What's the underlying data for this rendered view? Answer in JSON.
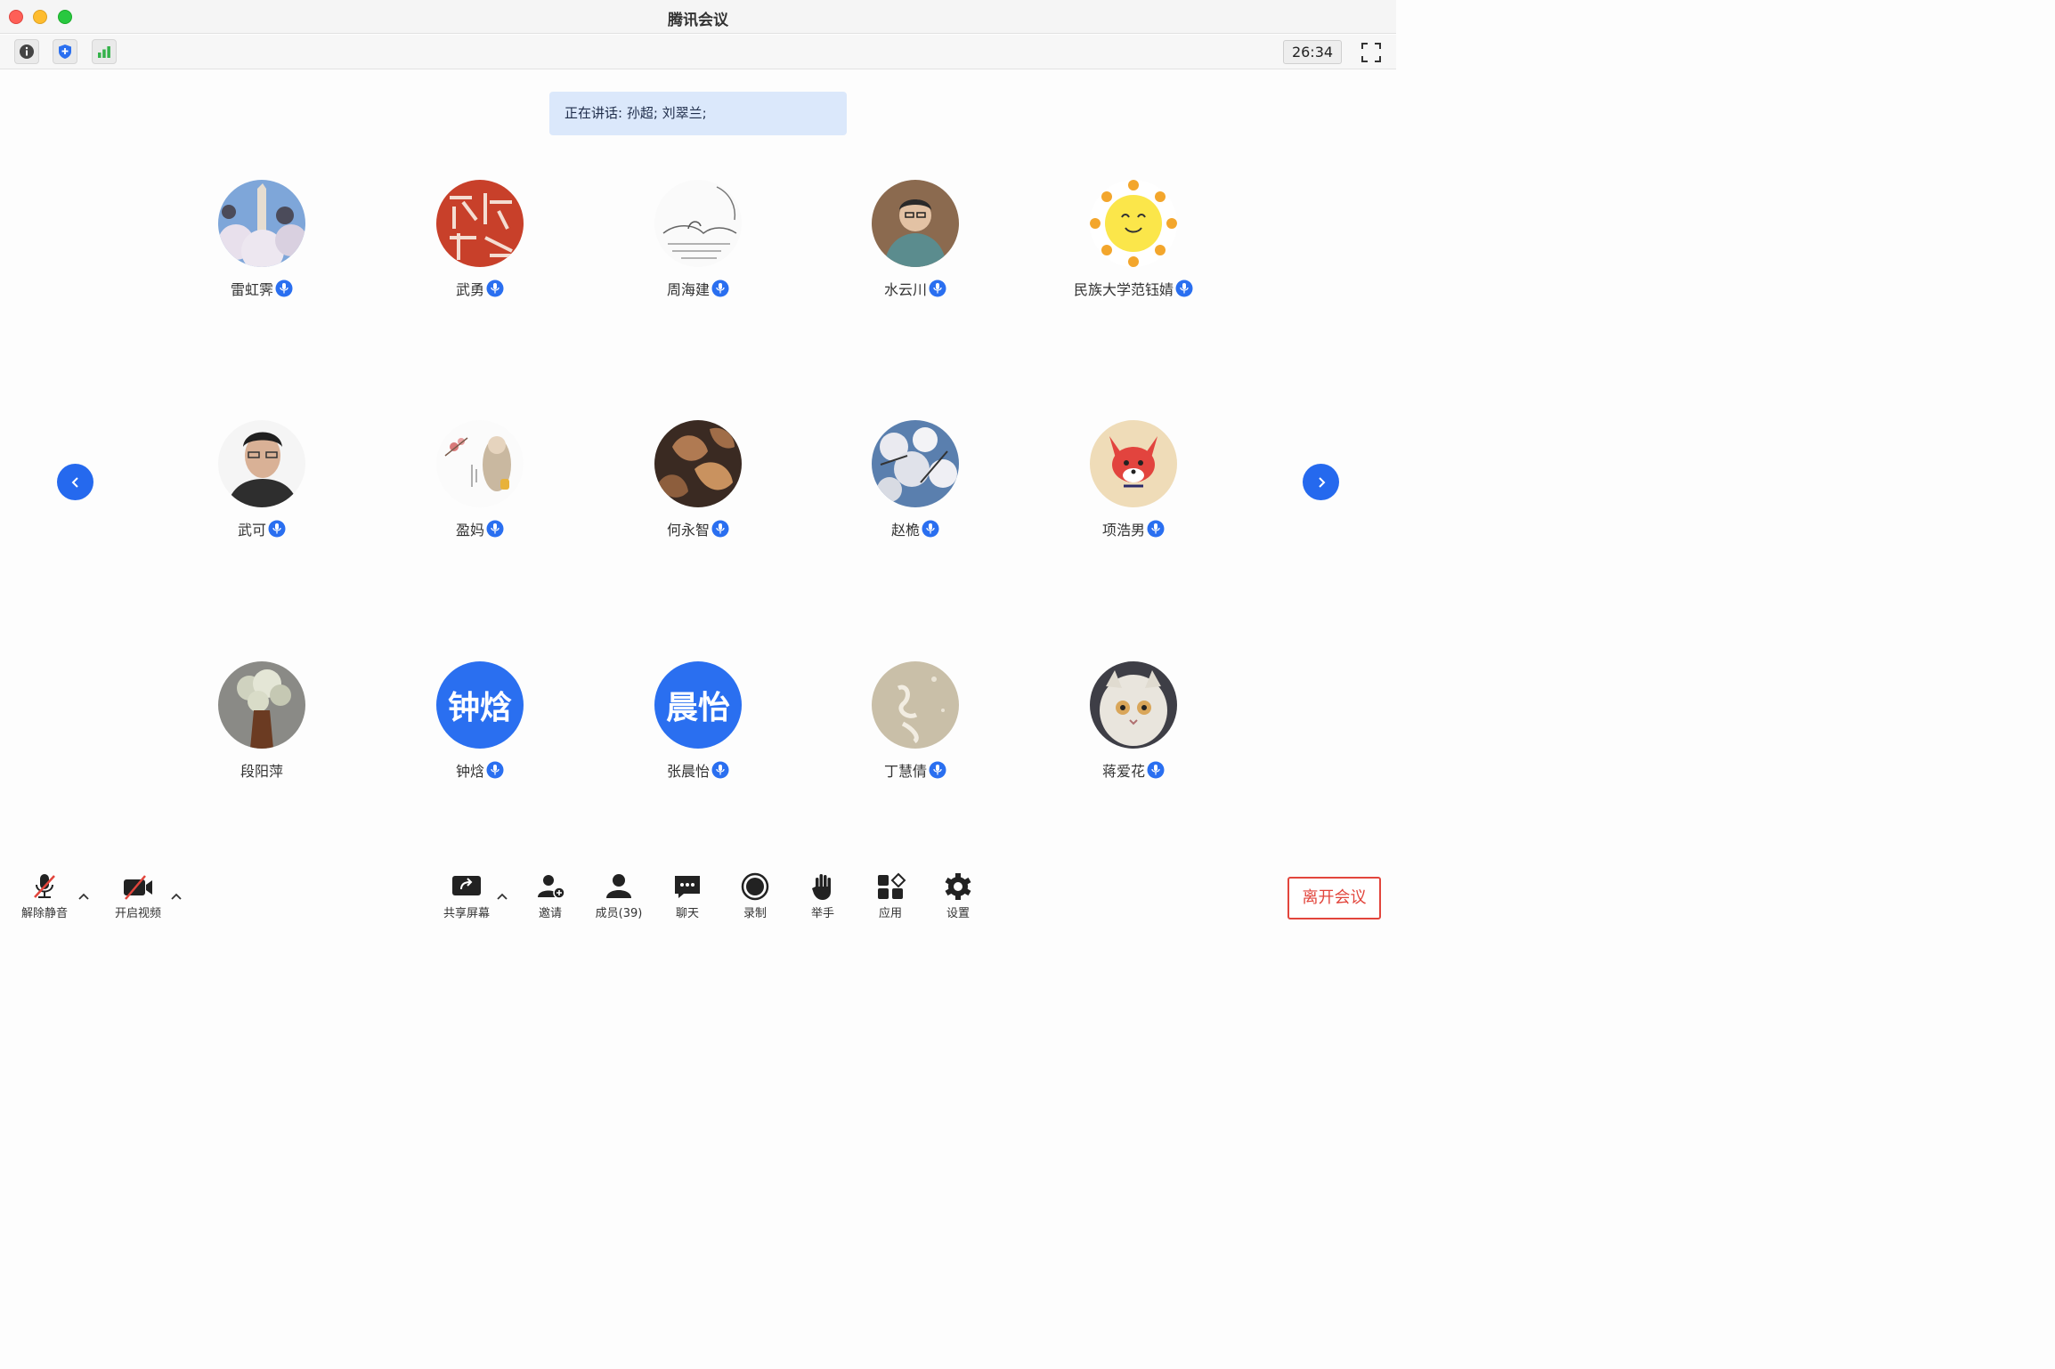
{
  "window": {
    "title": "腾讯会议"
  },
  "toolbar": {
    "timer": "26:34"
  },
  "speaking": {
    "text": "正在讲话: 孙超; 刘翠兰;"
  },
  "participants": [
    {
      "name": "雷虹霁"
    },
    {
      "name": "武勇"
    },
    {
      "name": "周海建"
    },
    {
      "name": "水云川"
    },
    {
      "name": "民族大学范钰婧"
    },
    {
      "name": "武可"
    },
    {
      "name": "盈妈"
    },
    {
      "name": "何永智"
    },
    {
      "name": "赵桅"
    },
    {
      "name": "项浩男"
    },
    {
      "name": "段阳萍"
    },
    {
      "name": "钟焓",
      "avatar_text": "钟焓"
    },
    {
      "name": "张晨怡",
      "avatar_text": "晨怡"
    },
    {
      "name": "丁慧倩"
    },
    {
      "name": "蒋爱花"
    }
  ],
  "bottombar": {
    "unmute": "解除静音",
    "start_video": "开启视频",
    "share_screen": "共享屏幕",
    "invite": "邀请",
    "members": "成员(39)",
    "chat": "聊天",
    "record": "录制",
    "raise_hand": "举手",
    "apps": "应用",
    "settings": "设置",
    "leave": "离开会议"
  },
  "colors": {
    "accent": "#2a6ff0",
    "leave": "#e2453c",
    "banner": "#dbe8fb"
  }
}
